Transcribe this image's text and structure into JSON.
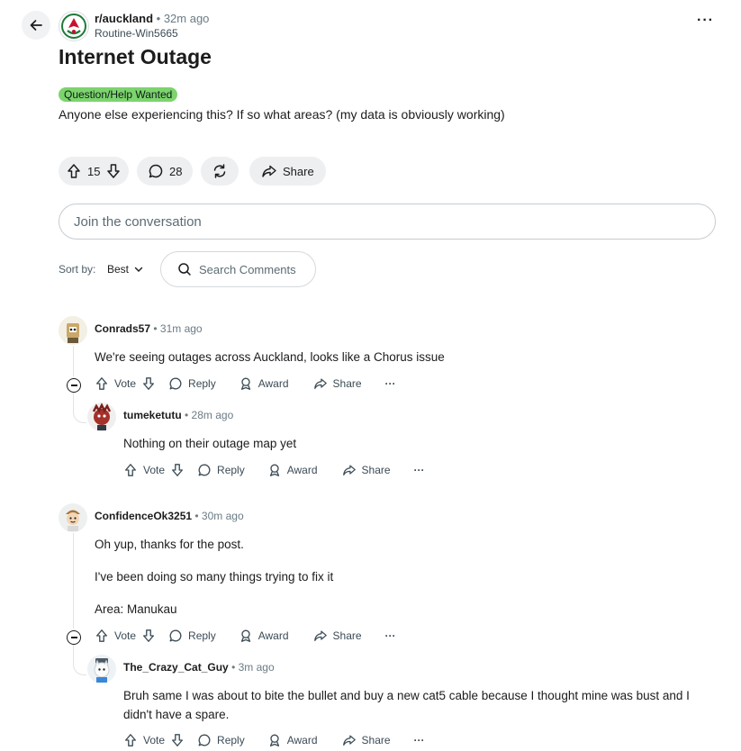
{
  "post": {
    "subreddit": "r/auckland",
    "time": "• 32m ago",
    "author": "Routine-Win5665",
    "title": "Internet Outage",
    "flair": "Question/Help Wanted",
    "flair_color": "#7cd46c",
    "body": "Anyone else experiencing this? If so what areas? (my data is obviously working)",
    "upvotes": "15",
    "comments": "28",
    "share_label": "Share"
  },
  "join_placeholder": "Join the conversation",
  "sort": {
    "label": "Sort by:",
    "value": "Best"
  },
  "search": {
    "placeholder": "Search Comments"
  },
  "actions": {
    "vote": "Vote",
    "reply": "Reply",
    "award": "Award",
    "share": "Share",
    "more": "···"
  },
  "comments": [
    {
      "author": "Conrads57",
      "time": "• 31m ago",
      "lines": [
        "We're seeing outages across Auckland, looks like a Chorus issue"
      ],
      "replies": [
        {
          "author": "tumeketutu",
          "time": "• 28m ago",
          "lines": [
            "Nothing on their outage map yet"
          ]
        }
      ]
    },
    {
      "author": "ConfidenceOk3251",
      "time": "• 30m ago",
      "lines": [
        "Oh yup, thanks for the post.",
        "I've been doing so many things trying to fix it",
        "Area: Manukau"
      ],
      "replies": [
        {
          "author": "The_Crazy_Cat_Guy",
          "time": "• 3m ago",
          "lines": [
            "Bruh same I was about to bite the bullet and buy a new cat5 cable because I thought mine was bust and I",
            "didn't have a spare."
          ]
        }
      ]
    }
  ],
  "icons": [
    "back-arrow-icon",
    "subreddit-icon",
    "more-icon",
    "upvote-icon",
    "downvote-icon",
    "comment-icon",
    "sync-icon",
    "share-icon",
    "search-icon",
    "chevron-down-icon",
    "reply-icon",
    "award-icon",
    "collapse-icon"
  ]
}
